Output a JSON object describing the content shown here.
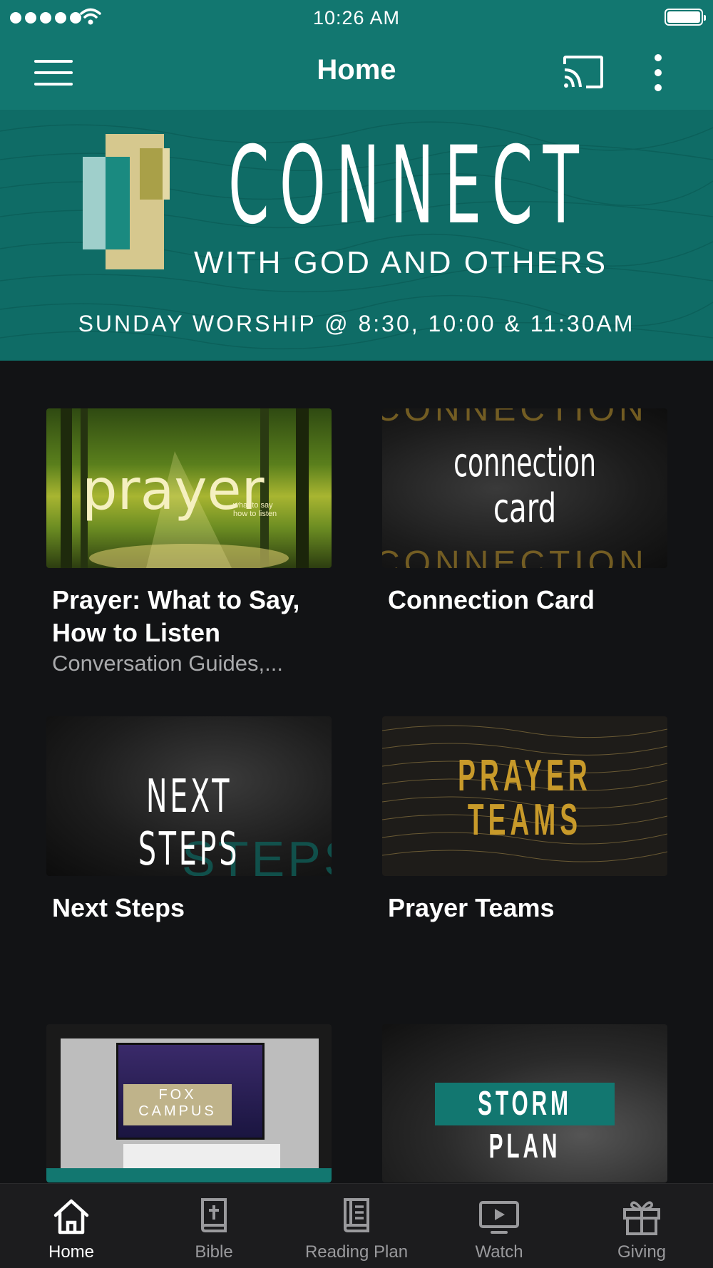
{
  "status": {
    "time": "10:26 AM"
  },
  "header": {
    "title": "Home"
  },
  "banner": {
    "title": "CONNECT",
    "subtitle": "WITH GOD AND OTHERS",
    "info": "SUNDAY WORSHIP @ 8:30, 10:00 & 11:30AM"
  },
  "cards": [
    {
      "title": "Prayer: What to Say, How to Listen",
      "subtitle": "Conversation Guides,...",
      "image_text": "prayer",
      "image_small": "what to say\nhow to listen"
    },
    {
      "title": "Connection Card",
      "image_text_1": "connection",
      "image_text_2": "card",
      "bg_word": "CONNECTION"
    },
    {
      "title": "Next Steps",
      "image_text": "NEXT STEPS",
      "bg_word": "STEPS"
    },
    {
      "title": "Prayer Teams",
      "image_text_1": "PRAYER",
      "image_text_2": "TEAMS"
    },
    {
      "title": "",
      "image_text_1": "FOX",
      "image_text_2": "CAMPUS"
    },
    {
      "title": "",
      "image_text": "STORM PLAN"
    }
  ],
  "tabs": [
    {
      "label": "Home",
      "icon": "home-icon",
      "active": true
    },
    {
      "label": "Bible",
      "icon": "bible-icon",
      "active": false
    },
    {
      "label": "Reading Plan",
      "icon": "reading-plan-icon",
      "active": false
    },
    {
      "label": "Watch",
      "icon": "watch-icon",
      "active": false
    },
    {
      "label": "Giving",
      "icon": "gift-icon",
      "active": false
    }
  ],
  "colors": {
    "brand": "#127770",
    "background": "#121315",
    "tab_bar": "#1c1c1e",
    "gold": "#c89a2a"
  }
}
